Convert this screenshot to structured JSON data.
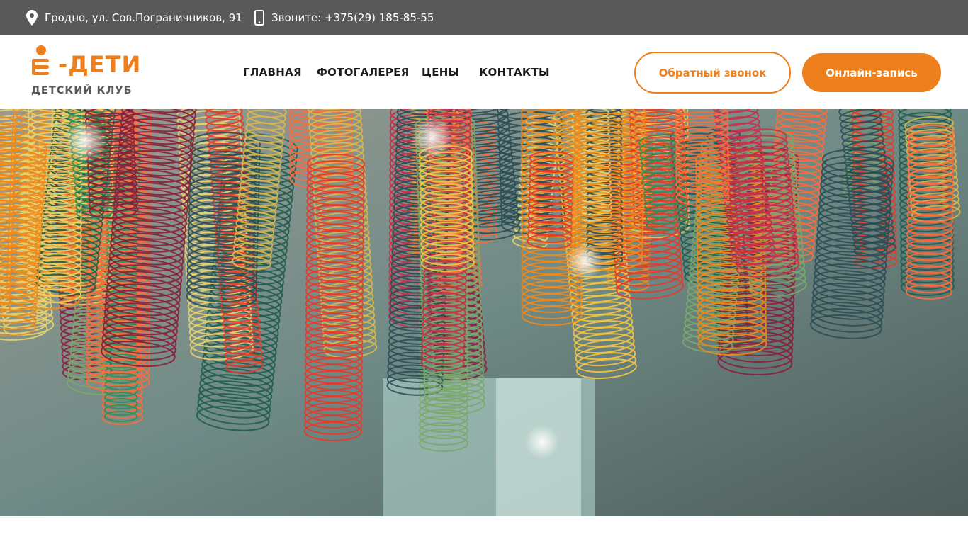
{
  "topbar": {
    "address": "Гродно, ул. Сов.Пограничников, 91",
    "phone": "Звоните: +375(29) 185-85-55",
    "icons": {
      "address": "location-pin-icon",
      "phone": "mobile-phone-icon"
    }
  },
  "logo": {
    "title": "-ДЕТИ",
    "subtitle": "ДЕТСКИЙ КЛУБ"
  },
  "nav": {
    "items": [
      {
        "label": "ГЛАВНАЯ"
      },
      {
        "label": "ФОТОГАЛЕРЕЯ"
      },
      {
        "label": "ЦЕНЫ"
      },
      {
        "label": "КОНТАКТЫ"
      }
    ]
  },
  "actions": {
    "callback_label": "Обратный звонок",
    "online_label": "Онлайн-запись"
  },
  "colors": {
    "accent": "#ee7f1d",
    "topbar_bg": "#595959",
    "text_dark": "#1a1a1a"
  }
}
